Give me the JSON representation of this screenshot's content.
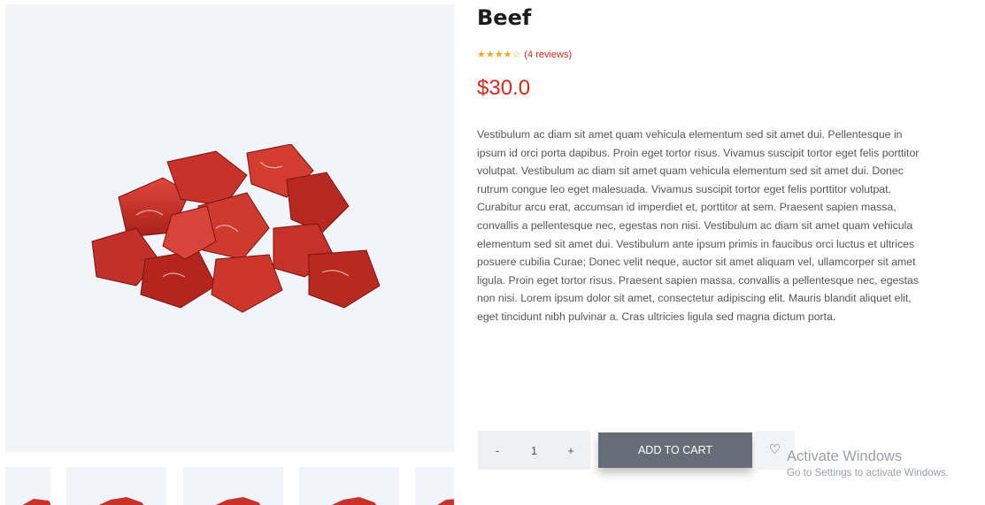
{
  "product": {
    "title": "Beef",
    "rating_stars": 4.5,
    "rating_max": 5,
    "reviews_text": "(4 reviews)",
    "price": "$30.0",
    "description": "Vestibulum ac diam sit amet quam vehicula elementum sed sit amet dui. Pellentesque in ipsum id orci porta dapibus. Proin eget tortor risus. Vivamus suscipit tortor eget felis porttitor volutpat. Vestibulum ac diam sit amet quam vehicula elementum sed sit amet dui. Donec rutrum congue leo eget malesuada. Vivamus suscipit tortor eget felis porttitor volutpat. Curabitur arcu erat, accumsan id imperdiet et, porttitor at sem. Praesent sapien massa, convallis a pellentesque nec, egestas non nisi. Vestibulum ac diam sit amet quam vehicula elementum sed sit amet dui. Vestibulum ante ipsum primis in faucibus orci luctus et ultrices posuere cubilia Curae; Donec velit neque, auctor sit amet aliquam vel, ullamcorper sit amet ligula. Proin eget tortor risus. Praesent sapien massa, convallis a pellentesque nec, egestas non nisi. Lorem ipsum dolor sit amet, consectetur adipiscing elit. Mauris blandit aliquet elit, eget tincidunt nibh pulvinar a. Cras ultricies ligula sed magna dictum porta."
  },
  "cart": {
    "minus_label": "-",
    "quantity": "1",
    "plus_label": "+",
    "add_to_cart_label": "ADD TO CART",
    "wishlist_icon": "heart-outline-icon"
  },
  "overlay": {
    "activate_title": "Activate Windows",
    "activate_subtitle": "Go to Settings to activate Windows."
  },
  "colors": {
    "price_red": "#d42a1e",
    "star_gold": "#f5a623",
    "cart_button": "#656d77",
    "image_bg": "#f1f5fa"
  }
}
